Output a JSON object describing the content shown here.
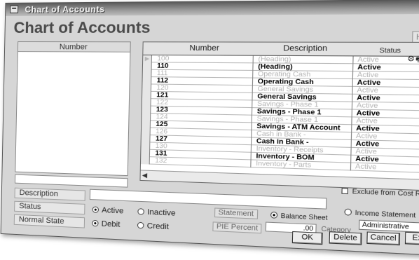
{
  "window": {
    "title": "Chart of Accounts"
  },
  "header": {
    "heading": "Chart of Accounts",
    "help_label": "Help"
  },
  "search": {
    "column_label": "Number",
    "value": ""
  },
  "grid": {
    "columns": [
      "Number",
      "Description",
      "Status"
    ],
    "tools": "⚙🖶▼",
    "rows": [
      {
        "number": "100",
        "description": "(Heading)",
        "status": "Active",
        "style": "dim",
        "selected": true
      },
      {
        "number": "110",
        "description": "(Heading)",
        "status": "Active",
        "style": "bold"
      },
      {
        "number": "111",
        "description": "Operating Cash",
        "status": "Active",
        "style": "dim"
      },
      {
        "number": "112",
        "description": "Operating Cash",
        "status": "Active",
        "style": "bold"
      },
      {
        "number": "120",
        "description": "General Savings",
        "status": "Active",
        "style": "dim"
      },
      {
        "number": "121",
        "description": "General Savings",
        "status": "Active",
        "style": "bold"
      },
      {
        "number": "122",
        "description": "Savings - Phase 1",
        "status": "Active",
        "style": "dim"
      },
      {
        "number": "123",
        "description": "Savings - Phase 1",
        "status": "Active",
        "style": "bold"
      },
      {
        "number": "124",
        "description": "Savings - Phase 1",
        "status": "Active",
        "style": "dim"
      },
      {
        "number": "125",
        "description": "Savings - ATM Account",
        "status": "Active",
        "style": "bold"
      },
      {
        "number": "126",
        "description": "Cash in Bank -",
        "status": "Active",
        "style": "dim"
      },
      {
        "number": "127",
        "description": "Cash in Bank -",
        "status": "Active",
        "style": "bold"
      },
      {
        "number": "130",
        "description": "Inventory - Receipts",
        "status": "Active",
        "style": "dim"
      },
      {
        "number": "131",
        "description": "Inventory - BOM",
        "status": "Active",
        "style": "bold"
      },
      {
        "number": "132",
        "description": "Inventory - Parts",
        "status": "Active",
        "style": "dim"
      }
    ]
  },
  "form": {
    "description_label": "Description",
    "description_value": "",
    "status_label": "Status",
    "status_options": [
      "Active",
      "Inactive"
    ],
    "status_selected": "Active",
    "normal_state_label": "Normal State",
    "normal_state_options": [
      "Debit",
      "Credit"
    ],
    "normal_state_selected": "Debit",
    "exclude_label": "Exclude from Cost Report",
    "statement_label": "Statement",
    "statement_options": [
      "Balance Sheet",
      "Income Statement"
    ],
    "statement_selected": "Balance Sheet",
    "pie_label": "PIE Percent",
    "pie_value": ".00",
    "category_label": "Category",
    "category_value": "Administrative"
  },
  "buttons": {
    "ok": "OK",
    "delete": "Delete",
    "cancel": "Cancel",
    "exit": "Exit"
  }
}
